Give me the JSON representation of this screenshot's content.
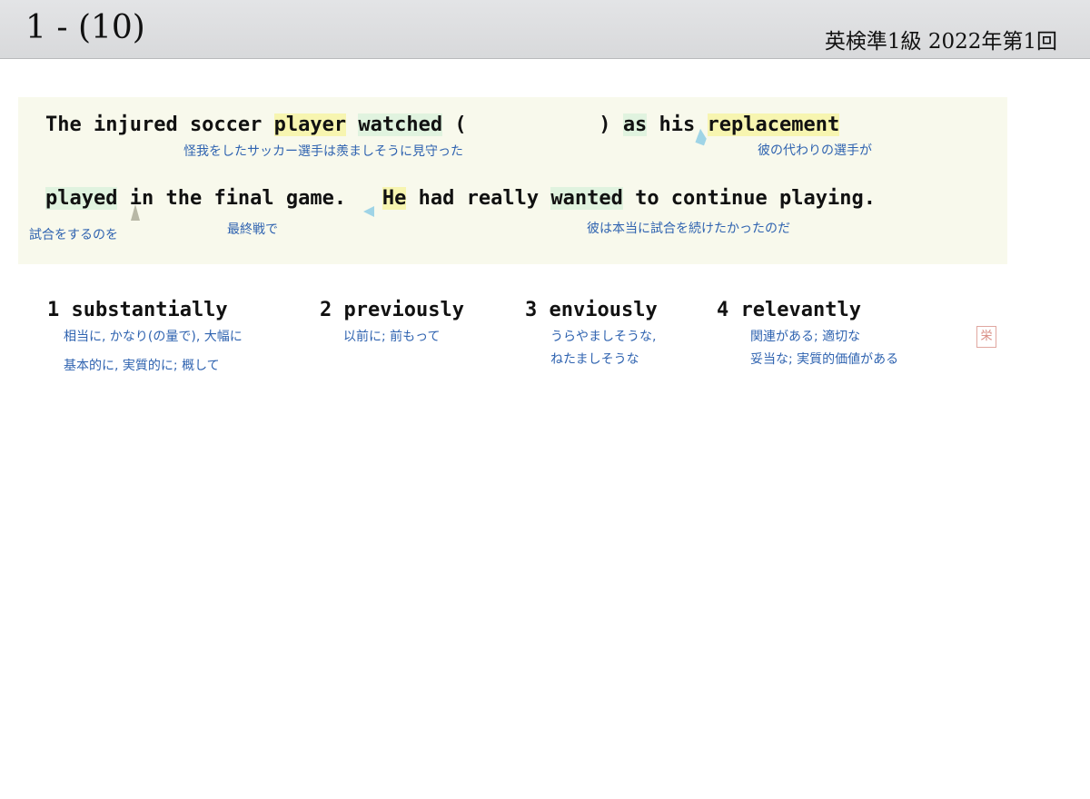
{
  "header": {
    "title": "1 - (10)",
    "exam": "英検準1級  2022年第1回"
  },
  "passage": {
    "line1": {
      "p1": "The injured soccer ",
      "player": "player",
      "sp1": " ",
      "watched": "watched",
      "p2": " (           ) ",
      "as": "as",
      "p3": " his ",
      "replacement": "replacement"
    },
    "line2": {
      "played": "played",
      "p1": " in the final game.   ",
      "he": "He",
      "p2": " had really ",
      "wanted": "wanted",
      "p3": " to continue playing."
    },
    "glosses": {
      "g1": "怪我をしたサッカー選手は羨ましそうに見守った",
      "g2": "彼の代わりの選手が",
      "g3": "試合をするのを",
      "g4": "最終戦で",
      "g5": "彼は本当に試合を続けたかったのだ"
    },
    "stamp": "栄"
  },
  "choices": [
    {
      "label": "1 substantially",
      "gloss1": "相当に, かなり(の量で), 大幅に",
      "gloss2": "基本的に, 実質的に; 概して"
    },
    {
      "label": "2 previously",
      "gloss1": "以前に; 前もって",
      "gloss2": ""
    },
    {
      "label": "3 enviously",
      "gloss1": "うらやましそうな,",
      "gloss2": "ねたましそうな"
    },
    {
      "label": "4 relevantly",
      "gloss1": "関連がある; 適切な",
      "gloss2": "妥当な; 実質的価値がある"
    }
  ],
  "colors": {
    "gloss": "#2f63b0",
    "highlight_yellow": "#f7f5b0",
    "highlight_green": "#e0f3df",
    "passage_bg": "#f8f9ec"
  }
}
